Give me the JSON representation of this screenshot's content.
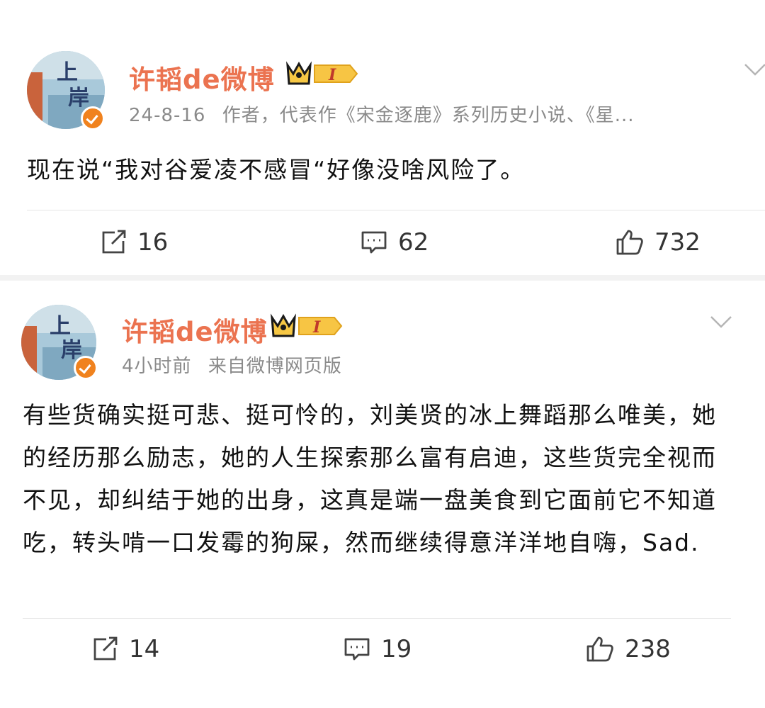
{
  "posts": [
    {
      "author": "许韬de微博",
      "vip_level": "I",
      "date": "24-8-16",
      "meta": "作者，代表作《宋金逐鹿》系列历史小说、《星...",
      "text": "现在说“我对谷爱凌不感冒“好像没啥风险了。",
      "actions": {
        "repost": "16",
        "comment": "62",
        "like": "732"
      }
    },
    {
      "author": "许韬de微博",
      "vip_level": "I",
      "date": "4小时前",
      "meta": "来自微博网页版",
      "text": "有些货确实挺可悲、挺可怜的，刘美贤的冰上舞蹈那么唯美，她的经历那么励志，她的人生探索那么富有启迪，这些货完全视而不见，却纠结于她的出身，这真是端一盘美食到它面前它不知道吃，转头啃一口发霉的狗屎，然而继续得意洋洋地自嗨，Sad.",
      "actions": {
        "repost": "14",
        "comment": "19",
        "like": "238"
      }
    }
  ],
  "avatar_lettering": "上岸",
  "colors": {
    "author": "#eb7350",
    "badge": "#f0821e",
    "meta": "#8a8a8a",
    "page_bg": "#f2f2f2"
  },
  "icons": [
    "repost-icon",
    "comment-icon",
    "like-icon",
    "more-chevron-icon",
    "vip-crown-icon",
    "verified-badge-icon"
  ]
}
